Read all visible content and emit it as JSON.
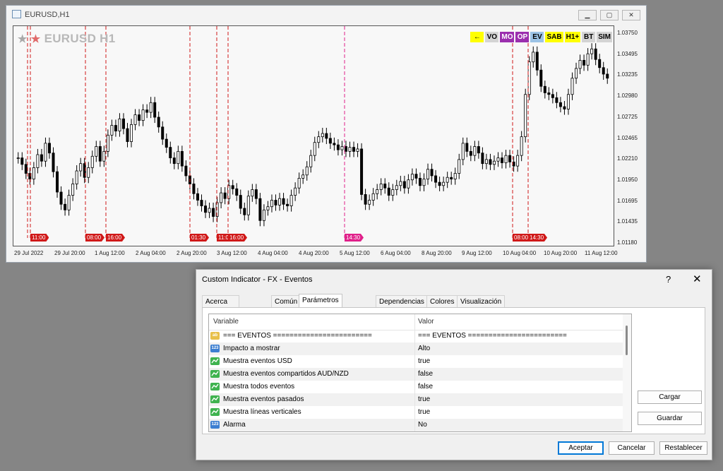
{
  "chart_window": {
    "title": "EURUSD,H1",
    "symbol": "EURUSD H1",
    "y_ticks": [
      "1.03750",
      "1.03495",
      "1.03235",
      "1.02980",
      "1.02725",
      "1.02465",
      "1.02210",
      "1.01950",
      "1.01695",
      "1.01435",
      "1.01180"
    ],
    "x_ticks": [
      "29 Jul 2022",
      "29 Jul 20:00",
      "1 Aug 12:00",
      "2 Aug 04:00",
      "2 Aug 20:00",
      "3 Aug 12:00",
      "4 Aug 04:00",
      "4 Aug 20:00",
      "5 Aug 12:00",
      "6 Aug 04:00",
      "8 Aug 20:00",
      "9 Aug 12:00",
      "10 Aug 04:00",
      "10 Aug 20:00",
      "11 Aug 12:00"
    ],
    "event_buttons": [
      {
        "label": "←",
        "bg": "#ffff00",
        "fg": "#000"
      },
      {
        "label": "VO",
        "bg": "#d4d4d4",
        "fg": "#000"
      },
      {
        "label": "MO",
        "bg": "#9b2fae",
        "fg": "#fff"
      },
      {
        "label": "OP",
        "bg": "#9b2fae",
        "fg": "#fff"
      },
      {
        "label": "EV",
        "bg": "#9cc3e6",
        "fg": "#000"
      },
      {
        "label": "SAB",
        "bg": "#ffff00",
        "fg": "#000"
      },
      {
        "label": "H1+",
        "bg": "#ffff00",
        "fg": "#000"
      },
      {
        "label": "BT",
        "bg": "#d4d4d4",
        "fg": "#000"
      },
      {
        "label": "SIM",
        "bg": "#d4d4d4",
        "fg": "#000"
      }
    ],
    "event_labels": [
      {
        "time": "11:00",
        "color": "#d01818"
      },
      {
        "time": "08:00",
        "color": "#d01818"
      },
      {
        "time": "16:00",
        "color": "#d01818"
      },
      {
        "time": "01:30",
        "color": "#d01818"
      },
      {
        "time": "11:00",
        "color": "#d01818"
      },
      {
        "time": "16:00",
        "color": "#d01818"
      },
      {
        "time": "14:30",
        "color": "#e0208a"
      },
      {
        "time": "08:00",
        "color": "#d01818"
      },
      {
        "time": "14:30",
        "color": "#d01818"
      }
    ],
    "candles_description_source": "price path",
    "chart_data": {
      "type": "candlestick",
      "ylim": [
        1.0114,
        1.0384
      ],
      "series": [
        {
          "values": [
            1.0222,
            1.0214,
            1.0203,
            1.0196,
            1.021,
            1.0226,
            1.0218,
            1.024,
            1.0228,
            1.0205,
            1.018,
            1.0165,
            1.0158,
            1.0176,
            1.019,
            1.0206,
            1.0215,
            1.0198,
            1.021,
            1.0224,
            1.0236,
            1.0218,
            1.023,
            1.025,
            1.0262,
            1.0255,
            1.027,
            1.0258,
            1.0242,
            1.0263,
            1.0275,
            1.0268,
            1.0281,
            1.0278,
            1.029,
            1.0272,
            1.026,
            1.0245,
            1.0235,
            1.0222,
            1.0215,
            1.023,
            1.0212,
            1.02,
            1.019,
            1.0178,
            1.017,
            1.0163,
            1.0155,
            1.016,
            1.015,
            1.0167,
            1.0179,
            1.0172,
            1.0188,
            1.0184,
            1.0176,
            1.016,
            1.0152,
            1.0175,
            1.0183,
            1.0172,
            1.0145,
            1.0158,
            1.0162,
            1.017,
            1.0164,
            1.0172,
            1.0165,
            1.0163,
            1.0176,
            1.0185,
            1.0197,
            1.0201,
            1.0211,
            1.0225,
            1.0241,
            1.0248,
            1.0252,
            1.0246,
            1.024,
            1.0238,
            1.0232,
            1.0236,
            1.023,
            1.0235,
            1.023,
            1.0233,
            1.0177,
            1.0165,
            1.017,
            1.0178,
            1.0183,
            1.019,
            1.0185,
            1.0176,
            1.0183,
            1.0188,
            1.0193,
            1.0185,
            1.0195,
            1.0202,
            1.0197,
            1.0188,
            1.0196,
            1.0208,
            1.02,
            1.0192,
            1.0188,
            1.0192,
            1.0198,
            1.0196,
            1.0203,
            1.022,
            1.024,
            1.023,
            1.0225,
            1.0236,
            1.0228,
            1.0215,
            1.022,
            1.0214,
            1.0218,
            1.0222,
            1.0216,
            1.0225,
            1.0217,
            1.0212,
            1.0225,
            1.0248,
            1.03,
            1.034,
            1.0352,
            1.033,
            1.031,
            1.0302,
            1.03,
            1.0296,
            1.029,
            1.0285,
            1.0282,
            1.03,
            1.032,
            1.0332,
            1.0342,
            1.0336,
            1.035,
            1.0356,
            1.0343,
            1.0333,
            1.0325,
            1.032
          ]
        }
      ]
    }
  },
  "dialog": {
    "title": "Custom Indicator - FX - Eventos",
    "help": "?",
    "close": "✕",
    "tabs": [
      "Acerca del programa",
      "Común",
      "Parámetros de entrada",
      "Dependencias",
      "Colores",
      "Visualización"
    ],
    "grid_header": {
      "variable": "Variable",
      "value": "Valor"
    },
    "rows": [
      {
        "icon": "ab",
        "icon_bg": "#e8c04a",
        "variable": "=== EVENTOS ========================",
        "value": "=== EVENTOS ========================"
      },
      {
        "icon": "123",
        "icon_bg": "#3d7fd1",
        "variable": "Impacto a mostrar",
        "value": "Alto"
      },
      {
        "icon": "bool",
        "icon_bg": "#3fb34f",
        "variable": "Muestra eventos USD",
        "value": "true"
      },
      {
        "icon": "bool",
        "icon_bg": "#3fb34f",
        "variable": "Muestra eventos compartidos AUD/NZD",
        "value": "false"
      },
      {
        "icon": "bool",
        "icon_bg": "#3fb34f",
        "variable": "Muestra todos eventos",
        "value": "false"
      },
      {
        "icon": "bool",
        "icon_bg": "#3fb34f",
        "variable": "Muestra eventos pasados",
        "value": "true"
      },
      {
        "icon": "bool",
        "icon_bg": "#3fb34f",
        "variable": "Muestra líneas verticales",
        "value": "true"
      },
      {
        "icon": "123",
        "icon_bg": "#3d7fd1",
        "variable": "Alarma",
        "value": "No"
      }
    ],
    "side_buttons": {
      "load": "Cargar",
      "save": "Guardar"
    },
    "footer_buttons": {
      "ok": "Aceptar",
      "cancel": "Cancelar",
      "reset": "Restablecer"
    }
  }
}
